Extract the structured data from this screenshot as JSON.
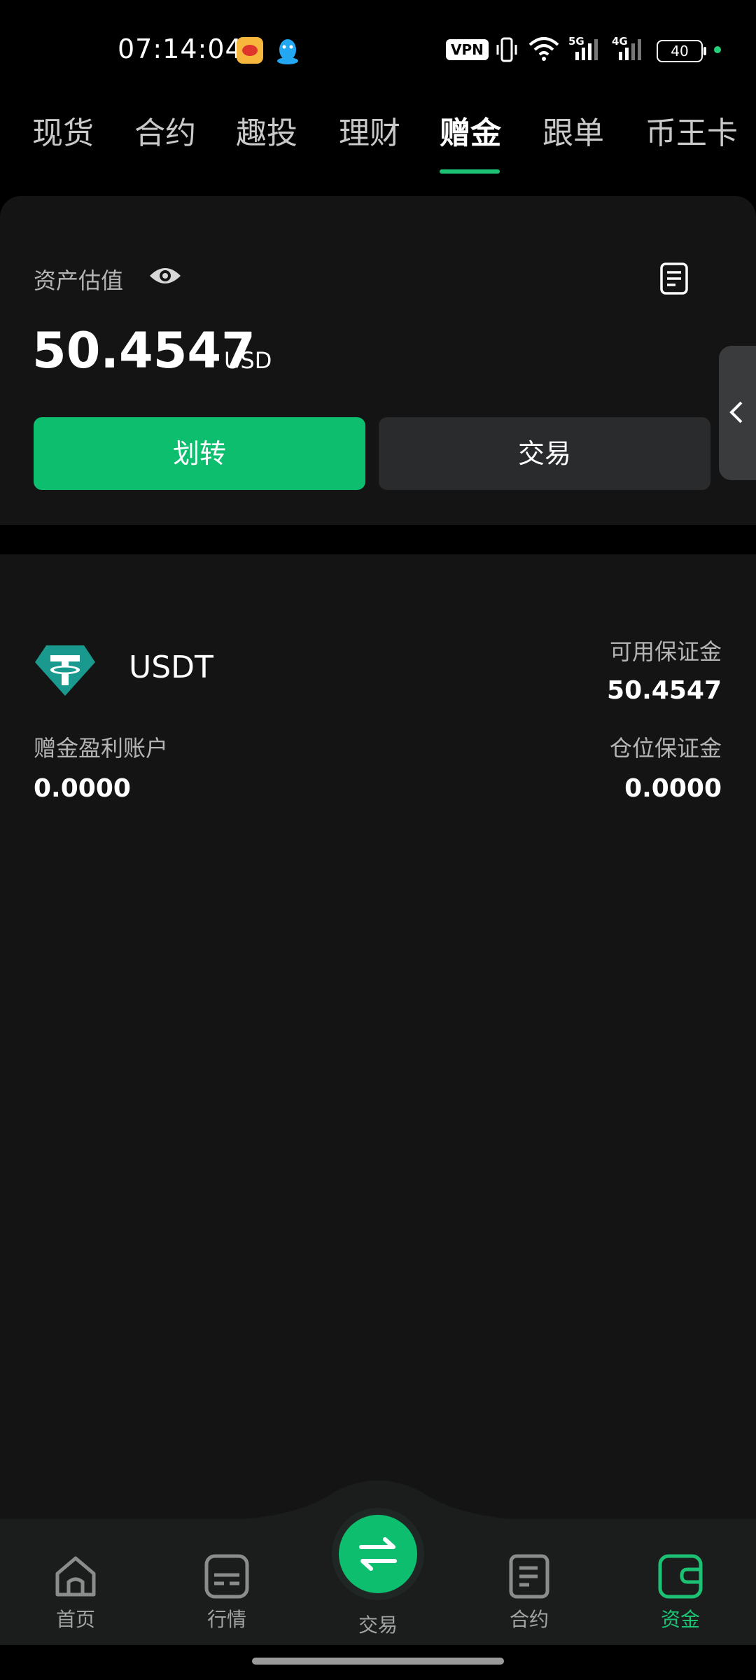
{
  "status_bar": {
    "time": "07:14:04",
    "vpn": "VPN",
    "net1": "5G",
    "net2": "4G",
    "battery": "40",
    "dot_color": "#25d07a"
  },
  "tabs": [
    {
      "label": "现货"
    },
    {
      "label": "合约"
    },
    {
      "label": "趣投"
    },
    {
      "label": "理财"
    },
    {
      "label": "赠金",
      "active": true
    },
    {
      "label": "跟单"
    },
    {
      "label": "币王卡"
    }
  ],
  "asset": {
    "label": "资产估值",
    "value": "50.4547",
    "unit": "USD",
    "transfer_button": "划转",
    "trade_button": "交易"
  },
  "account": {
    "coin": "USDT",
    "available_margin_label": "可用保证金",
    "available_margin_value": "50.4547",
    "bonus_profit_label": "赠金盈利账户",
    "bonus_profit_value": "0.0000",
    "position_margin_label": "仓位保证金",
    "position_margin_value": "0.0000"
  },
  "bottom_nav": {
    "items": [
      {
        "label": "首页",
        "icon": "home-icon"
      },
      {
        "label": "行情",
        "icon": "market-icon"
      },
      {
        "label": "交易",
        "icon": "swap-icon"
      },
      {
        "label": "合约",
        "icon": "contract-icon"
      },
      {
        "label": "资金",
        "icon": "wallet-icon",
        "active": true
      }
    ]
  },
  "colors": {
    "accent": "#0ebe6f",
    "background": "#141414",
    "usdt": "#1a9a8e"
  }
}
